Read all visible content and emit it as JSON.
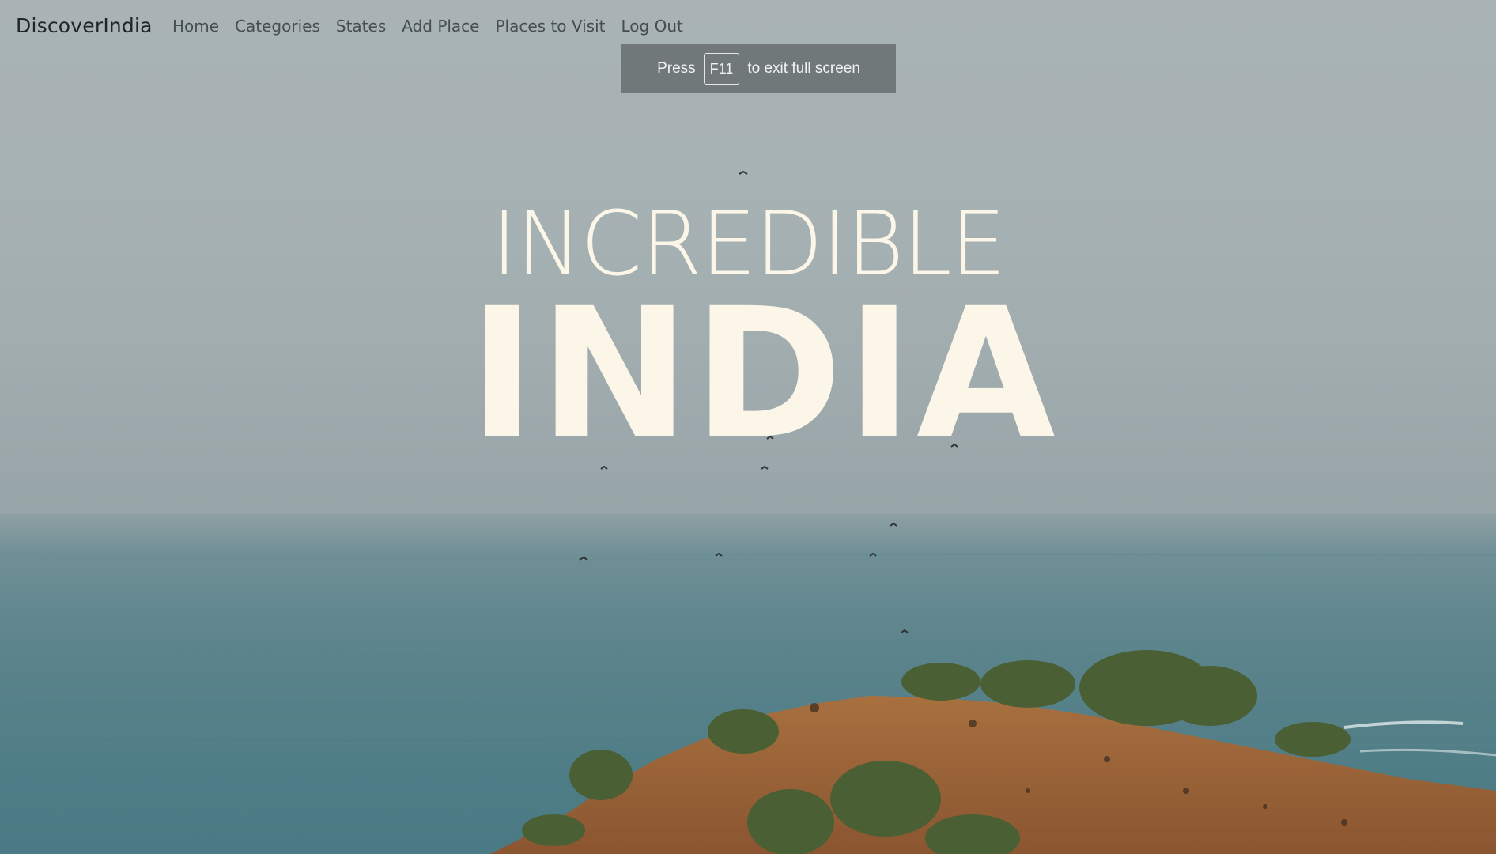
{
  "nav": {
    "brand": "DiscoverIndia",
    "links": [
      "Home",
      "Categories",
      "States",
      "Add Place",
      "Places to Visit",
      "Log Out"
    ]
  },
  "toast": {
    "prefix": "Press",
    "key": "F11",
    "suffix": "to exit full screen"
  },
  "hero": {
    "line1": "INCREDIBLE",
    "line2": "INDIA"
  },
  "colors": {
    "hero_text": "#fbf6e7",
    "sky": "#a9b3b5",
    "sea": "#4f7d86",
    "hill": "#a5683a",
    "toast_bg": "#717879"
  }
}
